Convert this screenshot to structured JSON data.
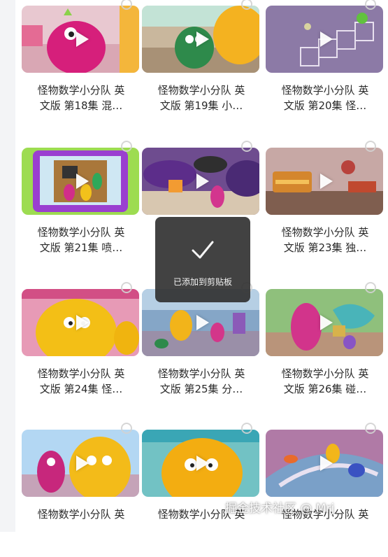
{
  "videos": [
    {
      "line1": "怪物数学小分队 英",
      "line2": "文版 第18集 混…"
    },
    {
      "line1": "怪物数学小分队 英",
      "line2": "文版 第19集 小…"
    },
    {
      "line1": "怪物数学小分队 英",
      "line2": "文版 第20集 怪…"
    },
    {
      "line1": "怪物数学小分队 英",
      "line2": "文版 第21集 喷…"
    },
    {
      "line1": "",
      "line2": ""
    },
    {
      "line1": "怪物数学小分队 英",
      "line2": "文版 第23集 独…"
    },
    {
      "line1": "怪物数学小分队 英",
      "line2": "文版 第24集 怪…"
    },
    {
      "line1": "怪物数学小分队 英",
      "line2": "文版 第25集 分…"
    },
    {
      "line1": "怪物数学小分队 英",
      "line2": "文版 第26集 碰…"
    },
    {
      "line1": "怪物数学小分队 英",
      "line2": ""
    },
    {
      "line1": "怪物数学小分队 英",
      "line2": ""
    },
    {
      "line1": "怪物数学小分队 英",
      "line2": ""
    }
  ],
  "toast": {
    "message": "已添加到剪贴板",
    "icon": "check-icon"
  },
  "watermark": "掘金技术社区 @ Mrj",
  "colors": {
    "toast_bg": "#323232",
    "title_text": "#2a2a2a"
  }
}
